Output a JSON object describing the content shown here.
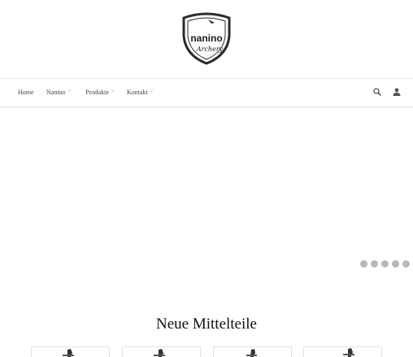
{
  "brand": {
    "logo_text": "nanino",
    "logo_subtext": "Archery"
  },
  "nav": {
    "items": [
      {
        "label": "Home",
        "has_dropdown": false
      },
      {
        "label": "Nanino",
        "has_dropdown": true
      },
      {
        "label": "Produkte",
        "has_dropdown": true
      },
      {
        "label": "Kontakt",
        "has_dropdown": true
      }
    ],
    "icons": [
      "search-icon",
      "user-icon"
    ]
  },
  "slider": {
    "dot_count": 5,
    "dot_color": "#b8b8b8"
  },
  "section": {
    "title": "Neue Mittelteile"
  },
  "colors": {
    "text": "#222222",
    "nav_text": "#444444",
    "border": "#e6e6e6"
  }
}
